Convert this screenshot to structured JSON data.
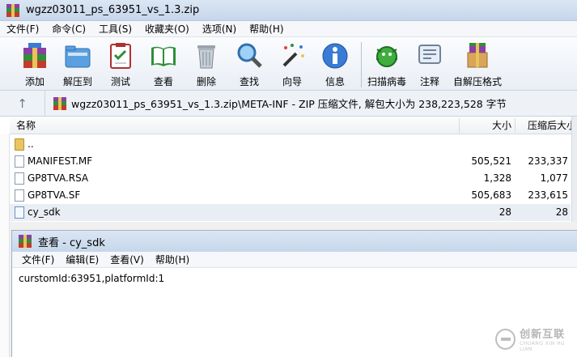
{
  "window": {
    "title": "wgzz03011_ps_63951_vs_1.3.zip"
  },
  "menu": [
    "文件(F)",
    "命令(C)",
    "工具(S)",
    "收藏夹(O)",
    "选项(N)",
    "帮助(H)"
  ],
  "toolbar": [
    {
      "label": "添加",
      "icon": "add-books-icon"
    },
    {
      "label": "解压到",
      "icon": "extract-folder-icon"
    },
    {
      "label": "测试",
      "icon": "test-clipboard-icon"
    },
    {
      "label": "查看",
      "icon": "view-book-icon"
    },
    {
      "label": "删除",
      "icon": "trash-icon"
    },
    {
      "label": "查找",
      "icon": "magnifier-icon"
    },
    {
      "label": "向导",
      "icon": "wizard-wand-icon"
    },
    {
      "label": "信息",
      "icon": "info-icon"
    },
    {
      "label": "扫描病毒",
      "icon": "virus-scan-icon"
    },
    {
      "label": "注释",
      "icon": "comment-icon"
    },
    {
      "label": "自解压格式",
      "icon": "sfx-box-icon"
    }
  ],
  "address": {
    "path": "wgzz03011_ps_63951_vs_1.3.zip\\META-INF - ZIP 压缩文件, 解包大小为 238,223,528 字节"
  },
  "columns": {
    "name": "名称",
    "size": "大小",
    "packed": "压缩后大小"
  },
  "files": [
    {
      "name": "..",
      "size": "",
      "packed": "",
      "type": "folder"
    },
    {
      "name": "MANIFEST.MF",
      "size": "505,521",
      "packed": "233,337",
      "type": "file"
    },
    {
      "name": "GP8TVA.RSA",
      "size": "1,328",
      "packed": "1,077",
      "type": "file"
    },
    {
      "name": "GP8TVA.SF",
      "size": "505,683",
      "packed": "233,615",
      "type": "file"
    },
    {
      "name": "cy_sdk",
      "size": "28",
      "packed": "28",
      "type": "file-selected"
    }
  ],
  "viewer": {
    "title": "查看 - cy_sdk",
    "menu": [
      "文件(F)",
      "编辑(E)",
      "查看(V)",
      "帮助(H)"
    ],
    "content": "curstomId:63951,platformId:1"
  },
  "watermark": {
    "cn": "创新互联",
    "en": "CHUANG XIN HU LIAN"
  },
  "colors": {
    "titlebar": "#c6d6ea",
    "selected_row": "#e9eef5"
  }
}
